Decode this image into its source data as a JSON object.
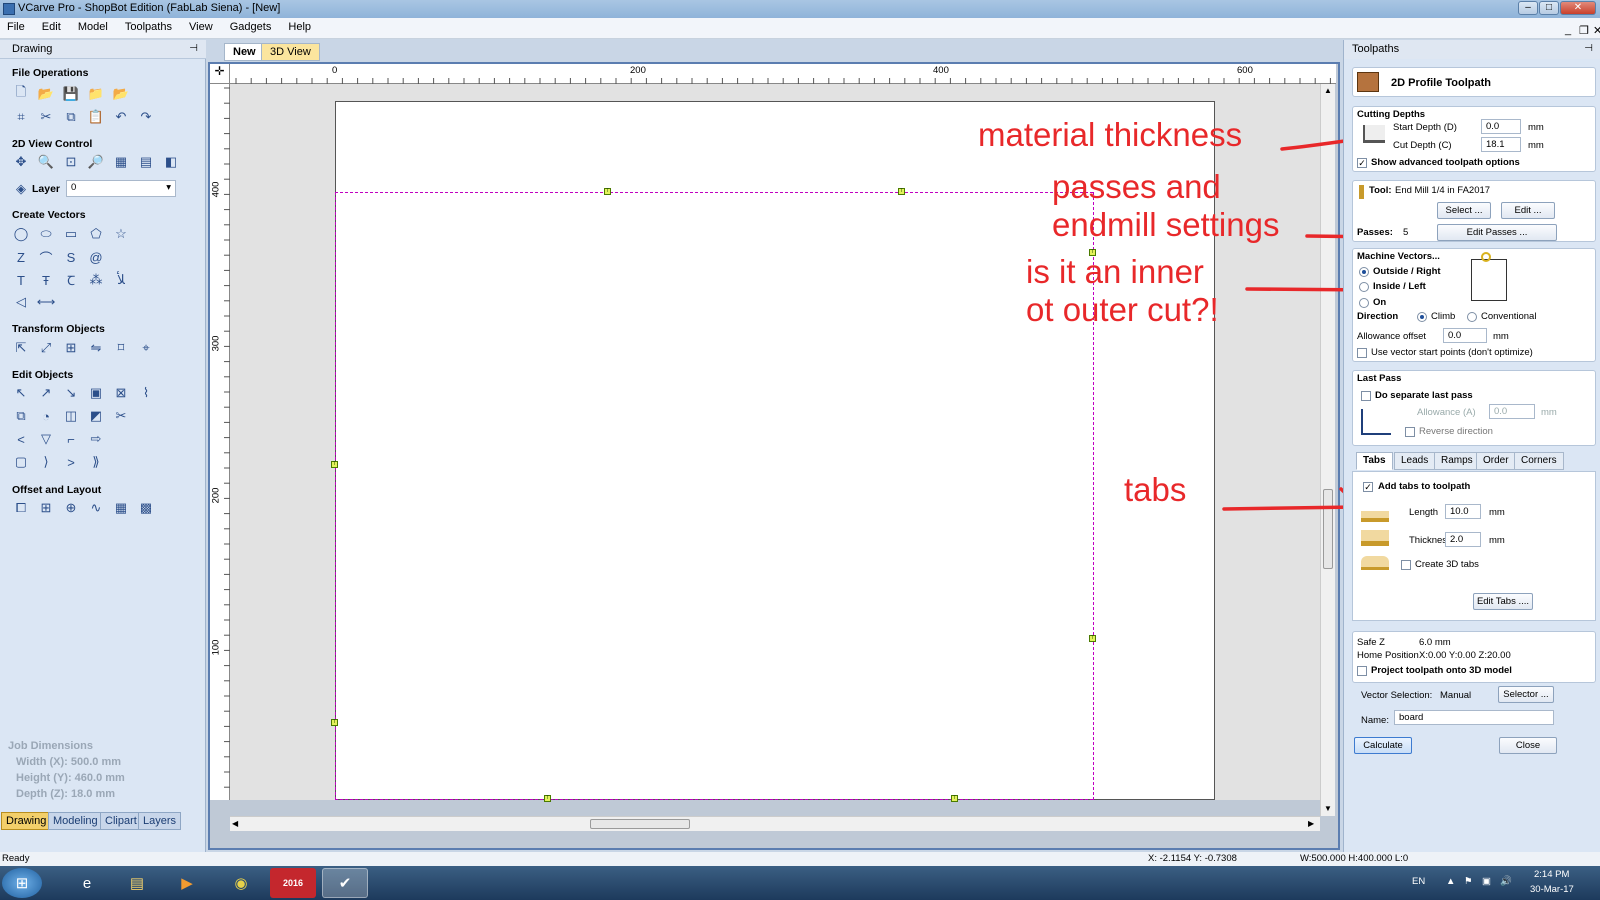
{
  "window": {
    "title": "VCarve Pro - ShopBot Edition (FabLab Siena) - [New]"
  },
  "menu": [
    "File",
    "Edit",
    "Model",
    "Toolpaths",
    "View",
    "Gadgets",
    "Help"
  ],
  "left": {
    "header": "Drawing",
    "sections": {
      "file_ops": "File Operations",
      "view_control": "2D View Control",
      "create_vectors": "Create Vectors",
      "transform": "Transform Objects",
      "edit_objects": "Edit Objects",
      "offset_layout": "Offset and Layout"
    },
    "layer_label": "Layer",
    "layer_value": "0",
    "job": {
      "title": "Job Dimensions",
      "width": "Width  (X): 500.0 mm",
      "height": "Height (Y): 460.0 mm",
      "depth": "Depth  (Z): 18.0 mm"
    },
    "bottom_tabs": [
      "Drawing",
      "Modeling",
      "Clipart",
      "Layers"
    ]
  },
  "view": {
    "tabs": [
      "New",
      "3D View"
    ],
    "ruler_top": [
      "0",
      "200",
      "400",
      "600"
    ],
    "ruler_left": [
      "400",
      "300",
      "200",
      "100"
    ]
  },
  "annotations": {
    "material": "material thickness",
    "passes_1": "passes and",
    "passes_2": "endmill settings",
    "cut_1": "is it an inner",
    "cut_2": "ot outer cut?!",
    "tabs": "tabs"
  },
  "right": {
    "header": "Toolpaths",
    "tool_title": "2D Profile Toolpath",
    "cutting_depths": "Cutting Depths",
    "start_depth_label": "Start Depth (D)",
    "start_depth": "0.0",
    "cut_depth_label": "Cut Depth (C)",
    "cut_depth": "18.1",
    "unit": "mm",
    "show_advanced": "Show advanced toolpath options",
    "tool_label": "Tool:",
    "tool_name": "End Mill 1/4 in FA2017",
    "select_btn": "Select ...",
    "edit_btn": "Edit ...",
    "passes_label": "Passes:",
    "passes": "5",
    "edit_passes_btn": "Edit Passes ...",
    "machine_vectors": "Machine Vectors...",
    "outside": "Outside / Right",
    "inside": "Inside / Left",
    "on": "On",
    "direction": "Direction",
    "climb": "Climb",
    "conventional": "Conventional",
    "allowance_label": "Allowance offset",
    "allowance": "0.0",
    "use_vector_start": "Use vector start points (don't optimize)",
    "last_pass": "Last Pass",
    "separate_last": "Do separate last pass",
    "allowance_a_label": "Allowance (A)",
    "allowance_a": "0.0",
    "reverse_direction": "Reverse direction",
    "tabs": [
      "Tabs",
      "Leads",
      "Ramps",
      "Order",
      "Corners"
    ],
    "add_tabs": "Add tabs to toolpath",
    "length_label": "Length",
    "length": "10.0",
    "thickness_label": "Thickness",
    "thickness": "2.0",
    "create_3d": "Create 3D tabs",
    "edit_tabs_btn": "Edit Tabs ....",
    "safe_z_label": "Safe Z",
    "safe_z": "6.0 mm",
    "home_label": "Home Position",
    "home": "X:0.00 Y:0.00 Z:20.00",
    "project": "Project toolpath onto 3D model",
    "vector_sel_label": "Vector Selection:",
    "vector_sel": "Manual",
    "selector_btn": "Selector ...",
    "name_label": "Name:",
    "name": "board",
    "calculate": "Calculate",
    "close": "Close"
  },
  "status": {
    "ready": "Ready",
    "coords": "X: -2.1154 Y: -0.7308",
    "size": "W:500.000  H:400.000  L:0"
  },
  "taskbar": {
    "lang": "EN",
    "time": "2:14 PM",
    "date": "30-Mar-17",
    "sw_label": "2016"
  },
  "colors": {
    "annotation": "#e8282a",
    "guide": "#c000c0",
    "accent": "#5b7db0"
  }
}
